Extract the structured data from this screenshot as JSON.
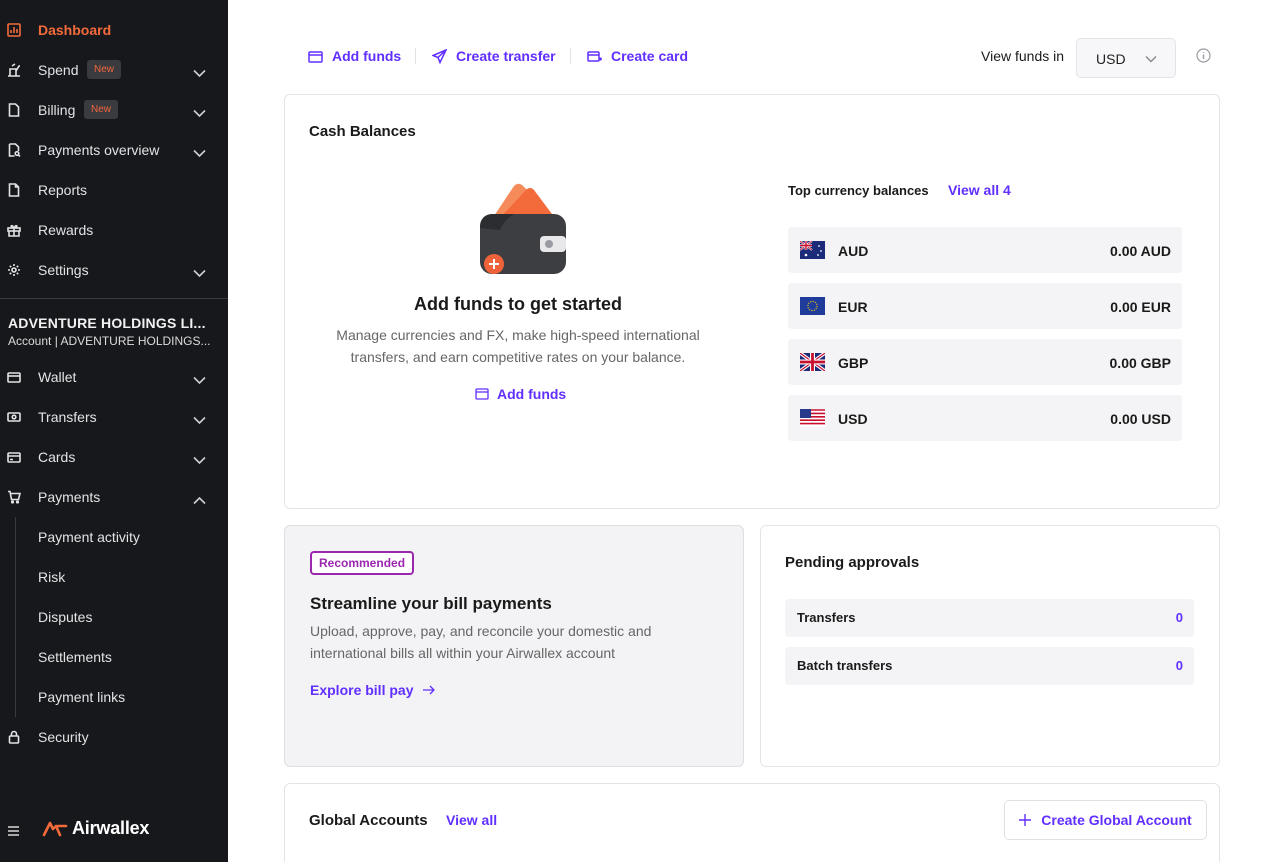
{
  "sidebar": {
    "items": [
      {
        "label": "Dashboard",
        "icon": "chart-bar-icon"
      },
      {
        "label": "Spend",
        "badge": "New",
        "icon": "receipt-icon"
      },
      {
        "label": "Billing",
        "badge": "New",
        "icon": "document-icon"
      },
      {
        "label": "Payments overview",
        "icon": "document-search-icon"
      },
      {
        "label": "Reports",
        "icon": "report-icon"
      },
      {
        "label": "Rewards",
        "icon": "gift-icon"
      },
      {
        "label": "Settings",
        "icon": "gear-icon"
      }
    ],
    "account": {
      "name": "ADVENTURE HOLDINGS LI...",
      "sub": "Account | ADVENTURE HOLDINGS..."
    },
    "account_items": [
      {
        "label": "Wallet",
        "icon": "wallet-icon"
      },
      {
        "label": "Transfers",
        "icon": "transfer-icon"
      },
      {
        "label": "Cards",
        "icon": "card-icon"
      },
      {
        "label": "Payments",
        "icon": "cart-icon"
      }
    ],
    "payments_sub": [
      "Payment activity",
      "Risk",
      "Disputes",
      "Settlements",
      "Payment links"
    ],
    "security": {
      "label": "Security",
      "icon": "lock-icon"
    },
    "logo_text": "Airwallex",
    "accent": "#F36B3B"
  },
  "toolbar": {
    "add_funds": "Add funds",
    "create_transfer": "Create transfer",
    "create_card": "Create card",
    "view_funds_label": "View funds in",
    "currency": "USD"
  },
  "cash": {
    "title": "Cash Balances",
    "empty_title": "Add funds to get started",
    "empty_desc_1": "Manage currencies and FX, make high-speed international",
    "empty_desc_2": "transfers, and earn competitive rates on your balance.",
    "add_funds": "Add funds",
    "top_label": "Top currency balances",
    "view_all": "View all 4",
    "balances": [
      {
        "code": "AUD",
        "amount": "0.00 AUD",
        "flag": "australia-flag"
      },
      {
        "code": "EUR",
        "amount": "0.00 EUR",
        "flag": "eu-flag"
      },
      {
        "code": "GBP",
        "amount": "0.00 GBP",
        "flag": "uk-flag"
      },
      {
        "code": "USD",
        "amount": "0.00 USD",
        "flag": "us-flag"
      }
    ]
  },
  "promo": {
    "badge": "Recommended",
    "title": "Streamline your bill payments",
    "desc_1": "Upload, approve, pay, and reconcile your domestic and",
    "desc_2": "international bills all within your Airwallex account",
    "link": "Explore bill pay",
    "badge_color": "#9B27AF"
  },
  "pending": {
    "title": "Pending approvals",
    "rows": [
      {
        "label": "Transfers",
        "value": "0"
      },
      {
        "label": "Batch transfers",
        "value": "0"
      }
    ]
  },
  "global": {
    "title": "Global Accounts",
    "view_all": "View all",
    "create": "Create Global Account"
  },
  "colors": {
    "link": "#612FFF",
    "sidebar_bg": "#17181B"
  }
}
